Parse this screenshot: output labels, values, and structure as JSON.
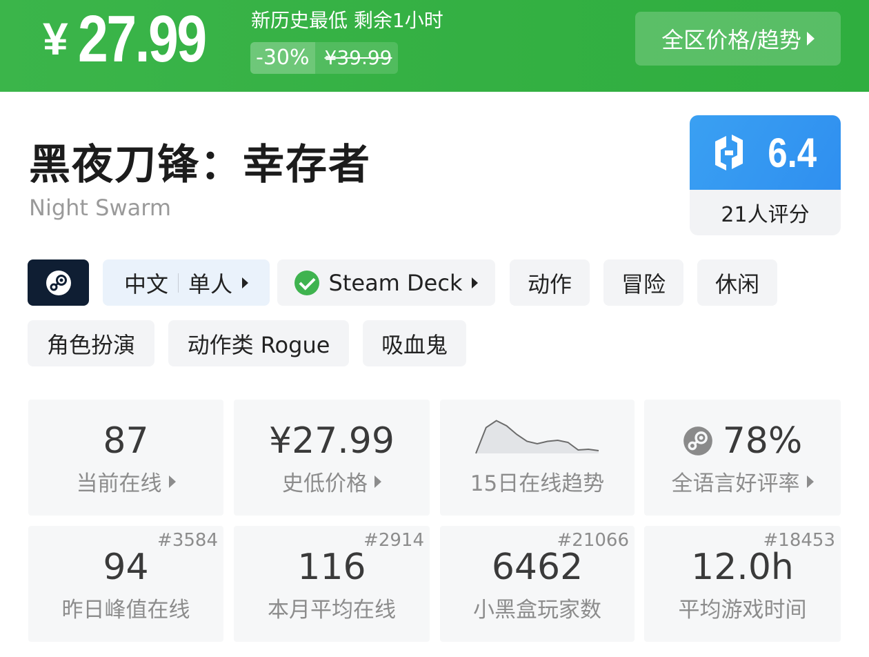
{
  "banner": {
    "currency": "¥",
    "price": "27.99",
    "deal_note": "新历史最低 剩余1小时",
    "discount": "-30%",
    "original_price": "¥39.99",
    "region_button": "全区价格/趋势",
    "color": "#34b043"
  },
  "game": {
    "title": "黑夜刀锋：幸存者",
    "subtitle": "Night Swarm"
  },
  "score": {
    "value": "6.4",
    "raters": "21人评分",
    "color": "#2f8ff0"
  },
  "tags": {
    "lang": "中文",
    "mode": "单人",
    "deck": "Steam Deck",
    "genres": [
      "动作",
      "冒险",
      "休闲",
      "角色扮演",
      "动作类 Rogue",
      "吸血鬼"
    ]
  },
  "stats": {
    "online_now": {
      "value": "87",
      "label": "当前在线"
    },
    "lowest_price": {
      "value": "¥27.99",
      "label": "史低价格"
    },
    "trend": {
      "label": "15日在线趋势",
      "values": [
        0.0,
        0.75,
        0.95,
        0.8,
        0.55,
        0.35,
        0.28,
        0.35,
        0.38,
        0.32,
        0.1,
        0.12,
        0.08
      ]
    },
    "positive_rate": {
      "value": "78%",
      "label": "全语言好评率"
    },
    "peak_yesterday": {
      "value": "94",
      "label": "昨日峰值在线",
      "rank": "#3584"
    },
    "monthly_avg": {
      "value": "116",
      "label": "本月平均在线",
      "rank": "#2914"
    },
    "players": {
      "value": "6462",
      "label": "小黑盒玩家数",
      "rank": "#21066"
    },
    "avg_playtime": {
      "value": "12.0h",
      "label": "平均游戏时间",
      "rank": "#18453"
    }
  }
}
